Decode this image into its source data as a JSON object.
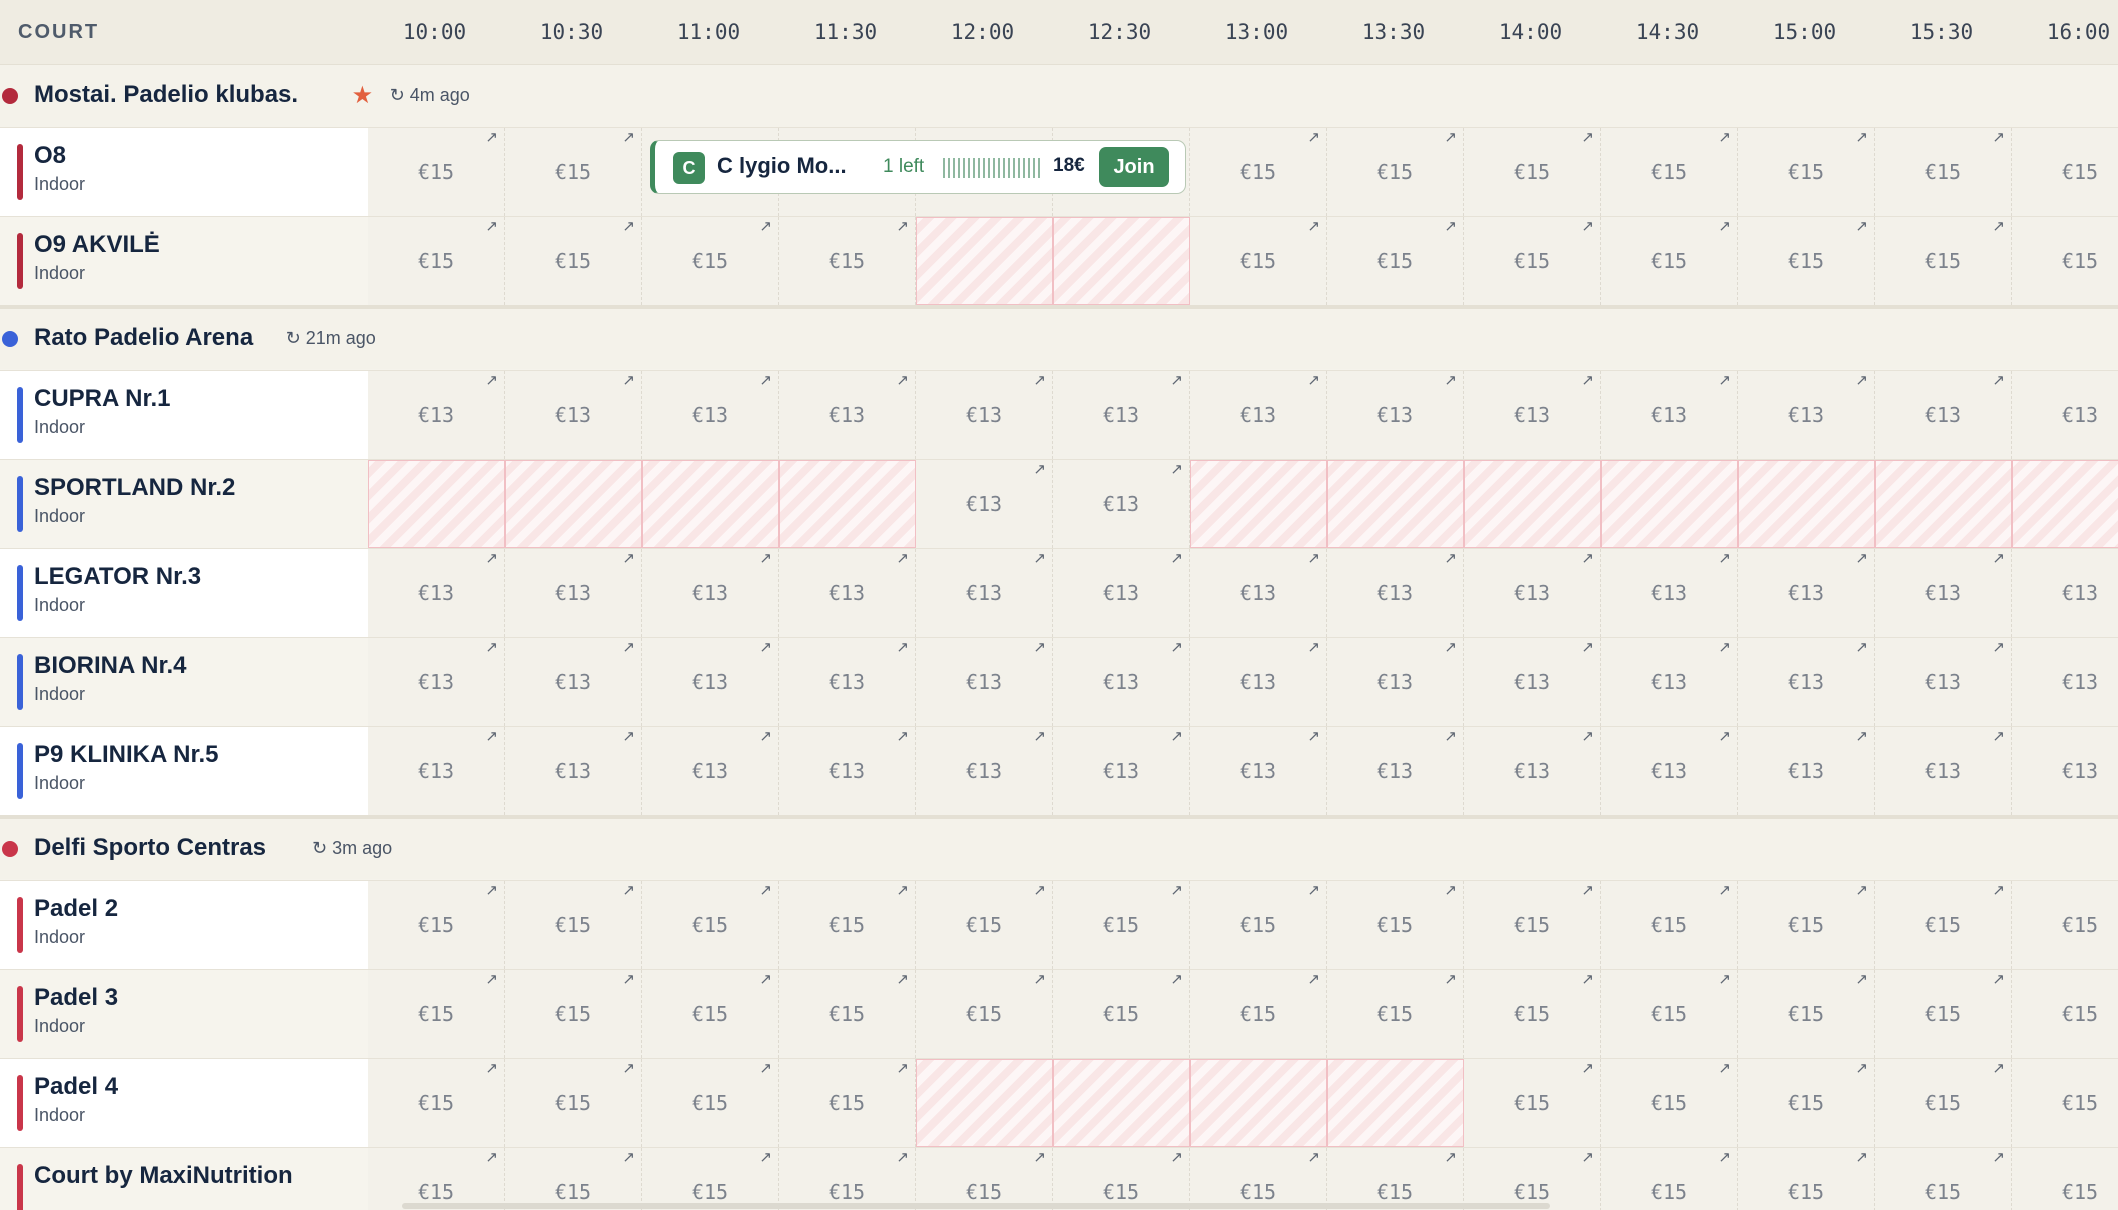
{
  "header": {
    "court_label": "COURT",
    "times": [
      "10:00",
      "10:30",
      "11:00",
      "11:30",
      "12:00",
      "12:30",
      "13:00",
      "13:30",
      "14:00",
      "14:30",
      "15:00",
      "15:30",
      "16:00"
    ]
  },
  "icons": {
    "refresh": "refresh-icon",
    "star": "star-icon",
    "external": "external-link-icon"
  },
  "colors": {
    "red": "#b32a3d",
    "blue": "#3a62d8",
    "green": "#3f8a5c",
    "booked": "#f9e6e6"
  },
  "venues": [
    {
      "name": "Mostai. Padelio klubas.",
      "color": "#b32a3d",
      "starred": true,
      "updated": "4m ago",
      "courts": [
        {
          "name": "O8",
          "type": "Indoor",
          "slots": [
            "€15",
            "€15",
            null,
            null,
            null,
            null,
            "€15",
            "€15",
            "€15",
            "€15",
            "€15",
            "€15",
            "€15"
          ],
          "booked": [],
          "event": {
            "badge": "C",
            "title": "C lygio Mo...",
            "spots_left": "1 left",
            "price": "18€",
            "action": "Join",
            "start": 2,
            "end": 6
          }
        },
        {
          "name": "O9 AKVILĖ",
          "type": "Indoor",
          "slots": [
            "€15",
            "€15",
            "€15",
            "€15",
            null,
            null,
            "€15",
            "€15",
            "€15",
            "€15",
            "€15",
            "€15",
            "€15"
          ],
          "booked": [
            4,
            5
          ]
        }
      ]
    },
    {
      "name": "Rato Padelio Arena",
      "color": "#3a62d8",
      "starred": false,
      "updated": "21m ago",
      "courts": [
        {
          "name": "CUPRA Nr.1",
          "type": "Indoor",
          "slots": [
            "€13",
            "€13",
            "€13",
            "€13",
            "€13",
            "€13",
            "€13",
            "€13",
            "€13",
            "€13",
            "€13",
            "€13",
            "€13"
          ],
          "booked": []
        },
        {
          "name": "SPORTLAND Nr.2",
          "type": "Indoor",
          "slots": [
            null,
            null,
            null,
            null,
            "€13",
            "€13",
            null,
            null,
            null,
            null,
            null,
            null,
            null
          ],
          "booked": [
            0,
            1,
            2,
            3,
            6,
            7,
            8,
            9,
            10,
            11,
            12
          ]
        },
        {
          "name": "LEGATOR Nr.3",
          "type": "Indoor",
          "slots": [
            "€13",
            "€13",
            "€13",
            "€13",
            "€13",
            "€13",
            "€13",
            "€13",
            "€13",
            "€13",
            "€13",
            "€13",
            "€13"
          ],
          "booked": []
        },
        {
          "name": "BIORINA Nr.4",
          "type": "Indoor",
          "slots": [
            "€13",
            "€13",
            "€13",
            "€13",
            "€13",
            "€13",
            "€13",
            "€13",
            "€13",
            "€13",
            "€13",
            "€13",
            "€13"
          ],
          "booked": []
        },
        {
          "name": "P9 KLINIKA Nr.5",
          "type": "Indoor",
          "slots": [
            "€13",
            "€13",
            "€13",
            "€13",
            "€13",
            "€13",
            "€13",
            "€13",
            "€13",
            "€13",
            "€13",
            "€13",
            "€13"
          ],
          "booked": []
        }
      ]
    },
    {
      "name": "Delfi Sporto Centras",
      "color": "#c9364a",
      "starred": false,
      "updated": "3m ago",
      "courts": [
        {
          "name": "Padel 2",
          "type": "Indoor",
          "slots": [
            "€15",
            "€15",
            "€15",
            "€15",
            "€15",
            "€15",
            "€15",
            "€15",
            "€15",
            "€15",
            "€15",
            "€15",
            "€15"
          ],
          "booked": []
        },
        {
          "name": "Padel 3",
          "type": "Indoor",
          "slots": [
            "€15",
            "€15",
            "€15",
            "€15",
            "€15",
            "€15",
            "€15",
            "€15",
            "€15",
            "€15",
            "€15",
            "€15",
            "€15"
          ],
          "booked": []
        },
        {
          "name": "Padel 4",
          "type": "Indoor",
          "slots": [
            "€15",
            "€15",
            "€15",
            "€15",
            null,
            null,
            null,
            null,
            "€15",
            "€15",
            "€15",
            "€15",
            "€15"
          ],
          "booked": [
            4,
            5,
            6,
            7
          ]
        },
        {
          "name": "Court by MaxiNutrition",
          "type": "",
          "slots": [
            "€15",
            "€15",
            "€15",
            "€15",
            "€15",
            "€15",
            "€15",
            "€15",
            "€15",
            "€15",
            "€15",
            "€15",
            "€15"
          ],
          "booked": []
        }
      ]
    }
  ]
}
